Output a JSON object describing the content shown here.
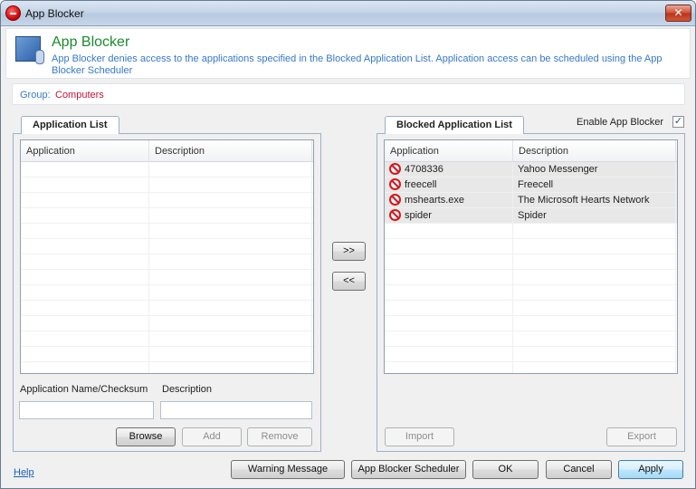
{
  "window": {
    "title": "App Blocker",
    "close_glyph": "✕"
  },
  "header": {
    "title": "App Blocker",
    "description": "App Blocker denies access to the applications specified in the Blocked Application List. Application access can be scheduled using the App Blocker Scheduler",
    "icon": "app-blocker-icon"
  },
  "group": {
    "label": "Group:",
    "value": "Computers"
  },
  "application_list": {
    "tab_label": "Application List",
    "columns": [
      "Application",
      "Description"
    ],
    "rows": [],
    "name_field_label": "Application Name/Checksum",
    "name_field_value": "",
    "description_field_label": "Description",
    "description_field_value": "",
    "browse_label": "Browse",
    "add_label": "Add",
    "remove_label": "Remove"
  },
  "transfer": {
    "add_label": ">>",
    "remove_label": "<<"
  },
  "blocked_list": {
    "tab_label": "Blocked Application List",
    "enable_label": "Enable App Blocker",
    "enable_checked": true,
    "columns": [
      "Application",
      "Description"
    ],
    "rows": [
      {
        "application": "4708336",
        "description": "Yahoo Messenger"
      },
      {
        "application": "freecell",
        "description": "Freecell"
      },
      {
        "application": "mshearts.exe",
        "description": "The Microsoft Hearts Network"
      },
      {
        "application": "spider",
        "description": "Spider"
      }
    ],
    "import_label": "Import",
    "export_label": "Export"
  },
  "footer": {
    "help_label": "Help",
    "warning_label": "Warning Message",
    "scheduler_label": "App Blocker Scheduler",
    "ok_label": "OK",
    "cancel_label": "Cancel",
    "apply_label": "Apply"
  },
  "colors": {
    "title_green": "#1d8a2e",
    "desc_blue": "#3579c9",
    "group_red": "#c0143c"
  }
}
